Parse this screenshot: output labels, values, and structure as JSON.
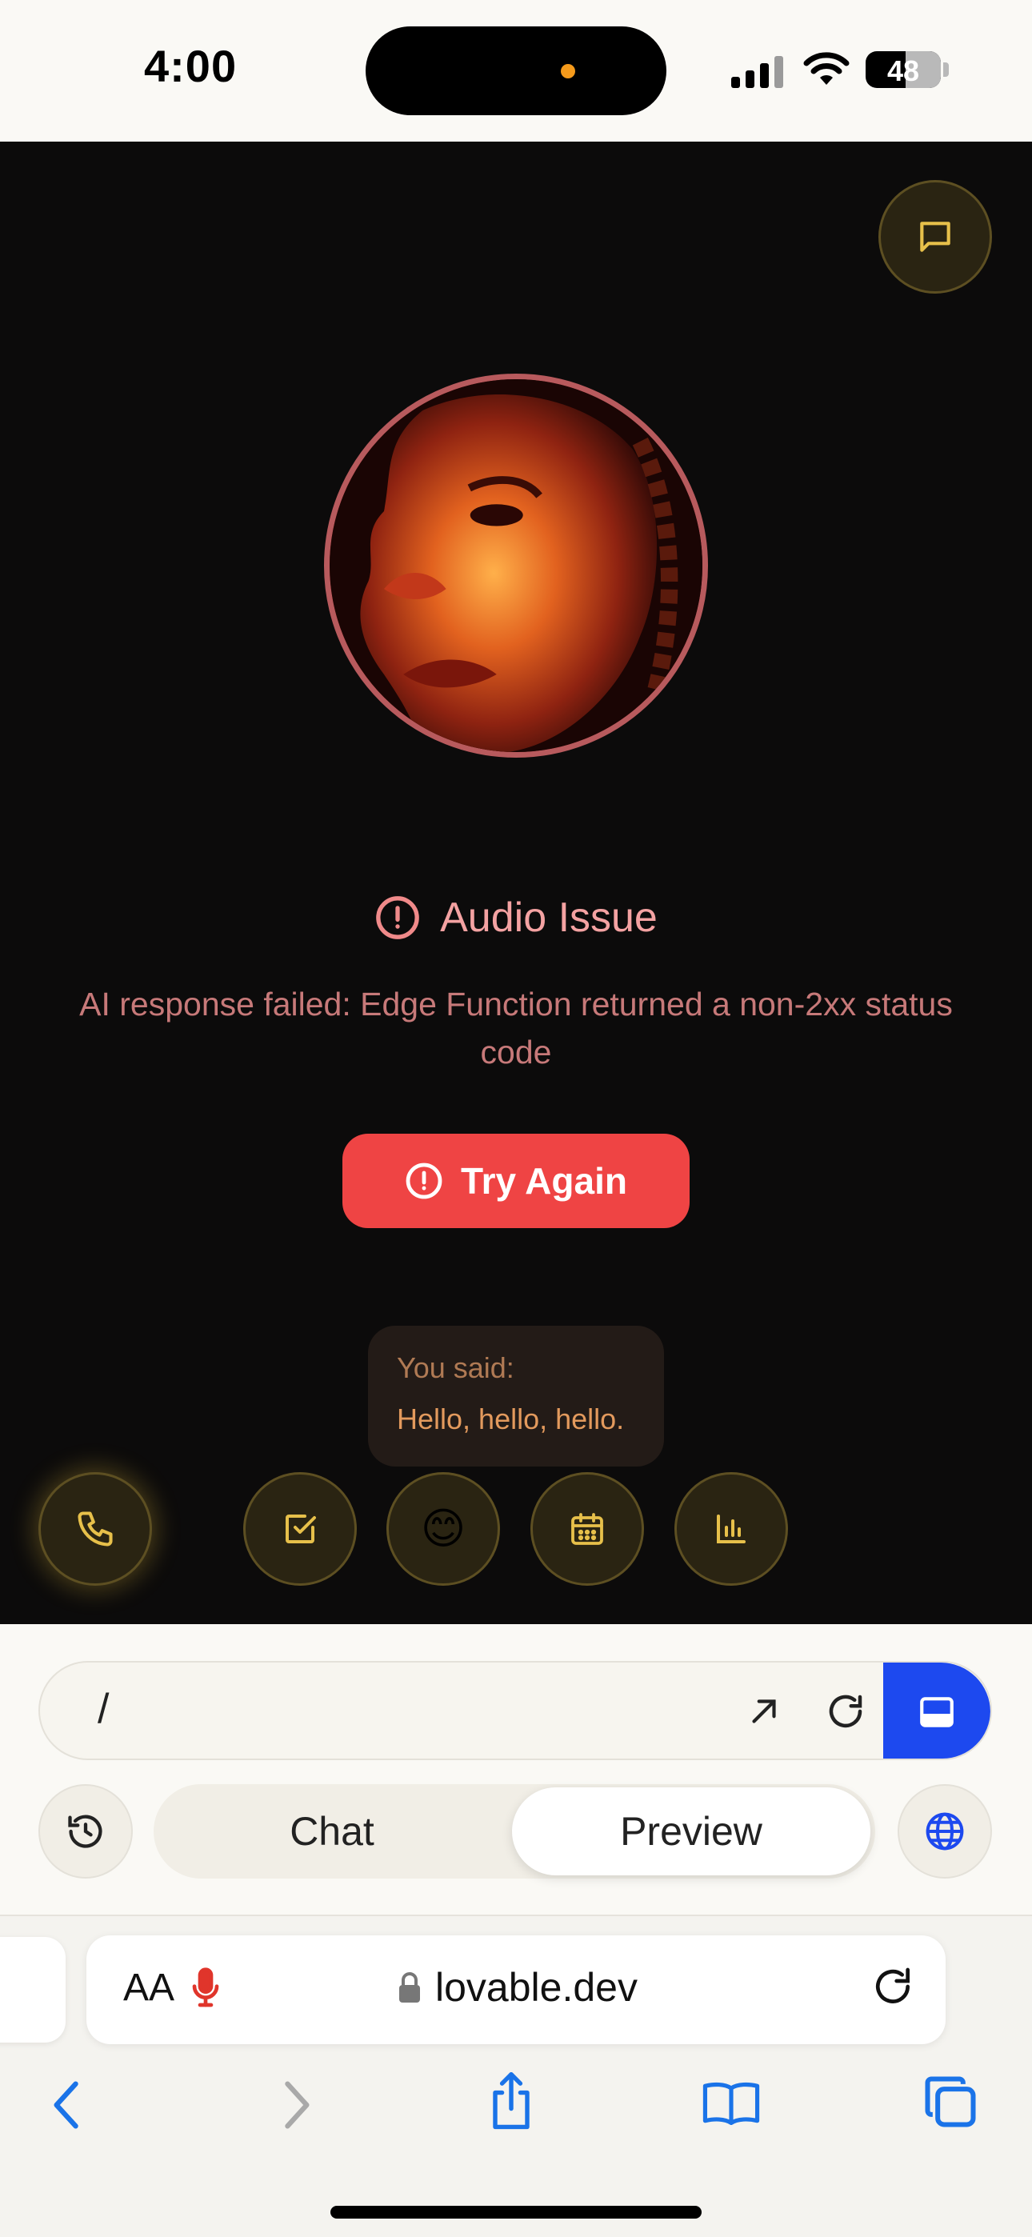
{
  "status_bar": {
    "time": "4:00",
    "battery": "48"
  },
  "hero": {
    "issue_title": "Audio Issue",
    "issue_description": "AI response failed: Edge Function returned a non-2xx status code",
    "retry_label": "Try Again"
  },
  "transcript": {
    "label": "You said:",
    "text": "Hello, hello, hello."
  },
  "action_buttons": [
    {
      "icon": "phone-icon"
    },
    {
      "icon": "checkbox-icon"
    },
    {
      "icon": "emoji-icon",
      "glyph": "😊"
    },
    {
      "icon": "calendar-icon"
    },
    {
      "icon": "bar-chart-icon"
    }
  ],
  "lovable_panel": {
    "url_path": "/",
    "tabs": [
      {
        "label": "Chat",
        "active": false
      },
      {
        "label": "Preview",
        "active": true
      }
    ]
  },
  "safari": {
    "text_size_label": "AA",
    "domain": "lovable.dev"
  },
  "colors": {
    "accent_red": "#ef4444",
    "accent_gold": "#e7c04a",
    "accent_blue": "#1d49ef",
    "app_background": "#0c0b0b"
  }
}
